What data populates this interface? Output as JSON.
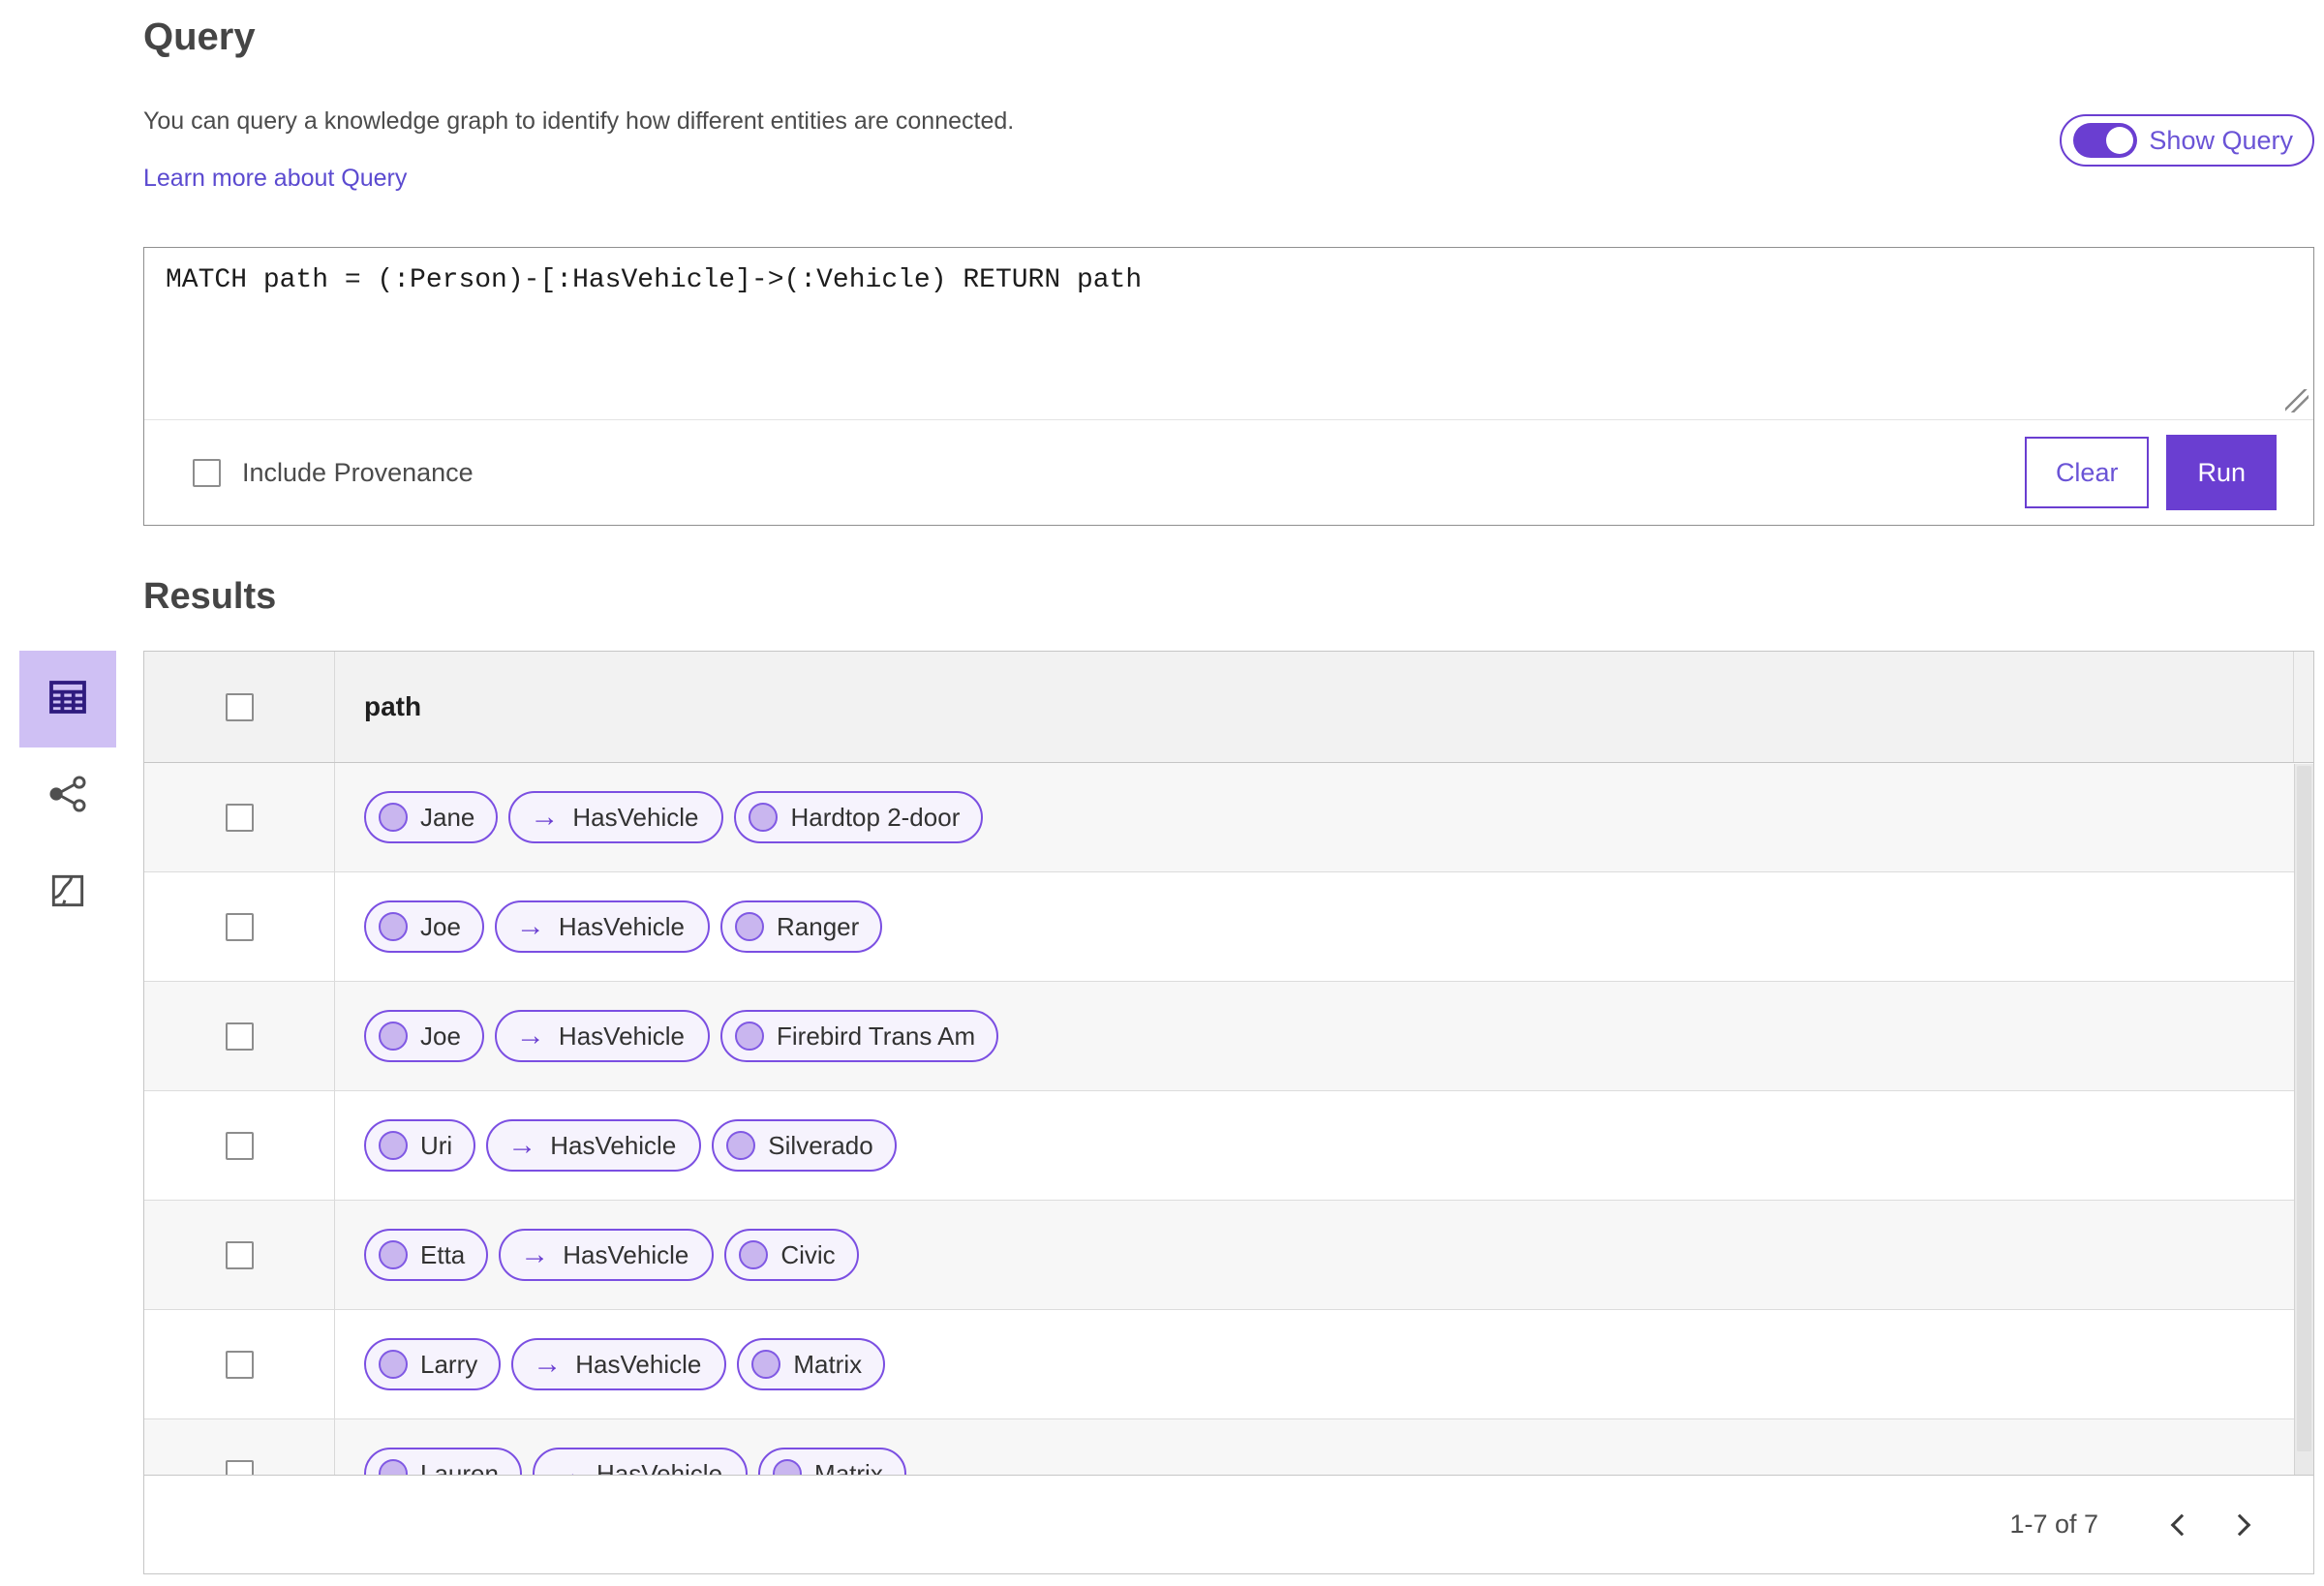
{
  "query_section": {
    "title": "Query",
    "description": "You can query a knowledge graph to identify how different entities are connected.",
    "learn_more_link": "Learn more about Query",
    "show_query_toggle": {
      "label": "Show Query",
      "state": "on"
    },
    "editor": {
      "value": "MATCH path = (:Person)-[:HasVehicle]->(:Vehicle) RETURN path"
    },
    "include_provenance": {
      "label": "Include Provenance",
      "checked": false
    },
    "buttons": {
      "clear": "Clear",
      "run": "Run"
    }
  },
  "results_section": {
    "title": "Results",
    "view_rail": [
      {
        "icon": "table-view-icon",
        "selected": true
      },
      {
        "icon": "graph-view-icon",
        "selected": false
      },
      {
        "icon": "map-view-icon",
        "selected": false
      }
    ],
    "table": {
      "column_header": "path",
      "rows": [
        {
          "source": "Jane",
          "relation": "HasVehicle",
          "target": "Hardtop 2-door"
        },
        {
          "source": "Joe",
          "relation": "HasVehicle",
          "target": "Ranger"
        },
        {
          "source": "Joe",
          "relation": "HasVehicle",
          "target": "Firebird Trans Am"
        },
        {
          "source": "Uri",
          "relation": "HasVehicle",
          "target": "Silverado"
        },
        {
          "source": "Etta",
          "relation": "HasVehicle",
          "target": "Civic"
        },
        {
          "source": "Larry",
          "relation": "HasVehicle",
          "target": "Matrix"
        },
        {
          "source": "Lauren",
          "relation": "HasVehicle",
          "target": "Matrix"
        }
      ]
    },
    "pagination": {
      "range_label": "1-7 of 7",
      "prev_icon": "chevron-left",
      "next_icon": "chevron-right"
    }
  },
  "icons": {
    "arrow_right": "→"
  },
  "colors": {
    "accent_purple": "#6a3ed1",
    "link_purple": "#5b4ad0",
    "pill_border": "#7b4fe2",
    "pill_background": "#f6f3fd",
    "pill_dot_fill": "#c9b6ef",
    "selected_tile_background": "#cfc0f4",
    "selected_icon_indigo": "#2f1b7e",
    "header_row_background": "#f2f2f2",
    "zebra_row_background": "#f7f7f7"
  }
}
